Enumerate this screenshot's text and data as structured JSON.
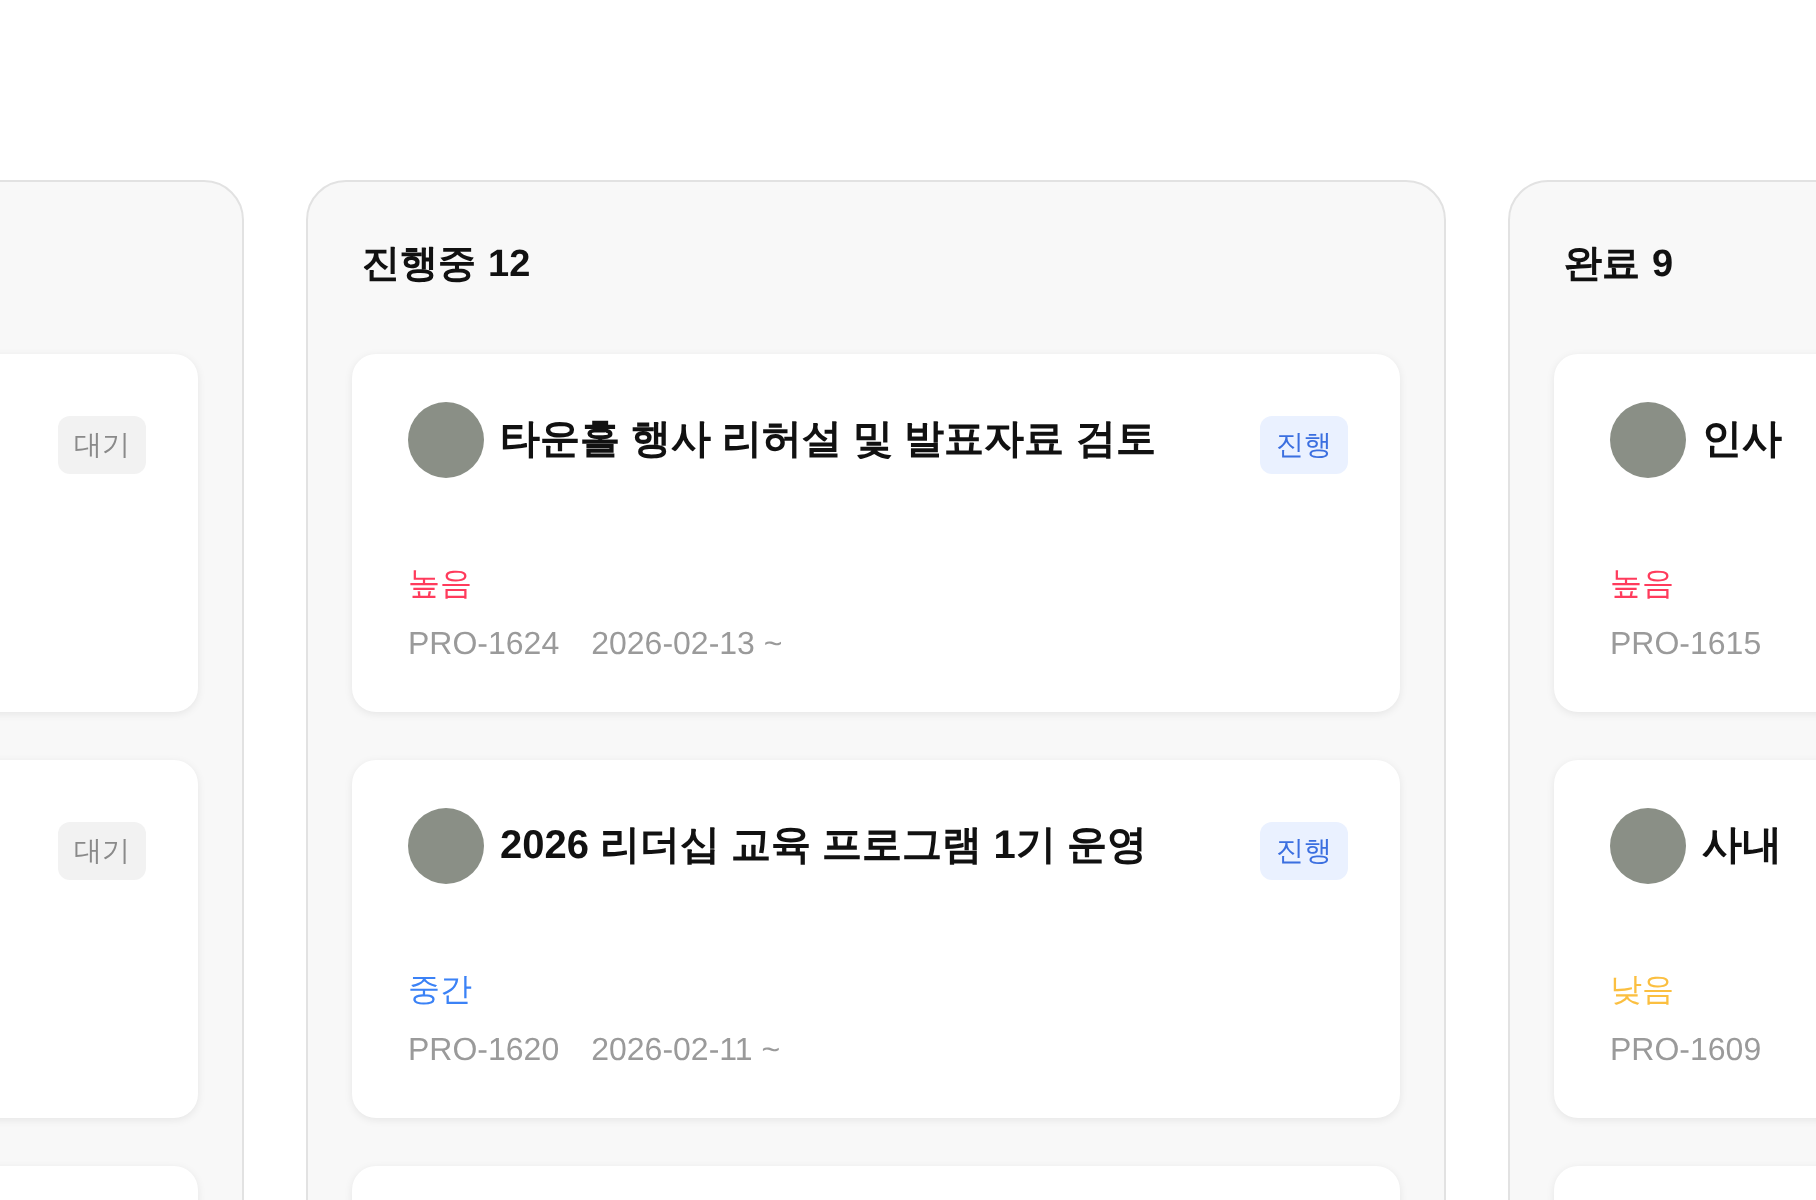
{
  "columns": [
    {
      "cards": [
        {
          "kind": "task",
          "status": {
            "label": "대기",
            "kind": "waiting"
          }
        },
        {
          "kind": "task",
          "status": {
            "label": "대기",
            "kind": "waiting"
          }
        },
        {
          "kind": "task"
        }
      ]
    },
    {
      "title": "진행중",
      "count": "12",
      "cards": [
        {
          "kind": "task",
          "title": "타운홀 행사 리허설 및 발표자료 검토",
          "status": {
            "label": "진행",
            "kind": "progress"
          },
          "priority": {
            "label": "높음",
            "color": "#ff3b5c"
          },
          "id": "PRO-1624",
          "date": "2026-02-13 ~"
        },
        {
          "kind": "task",
          "title": "2026 리더십 교육 프로그램 1기 운영",
          "status": {
            "label": "진행",
            "kind": "progress"
          },
          "priority": {
            "label": "중간",
            "color": "#3b82f6"
          },
          "id": "PRO-1620",
          "date": "2026-02-11 ~"
        },
        {
          "kind": "task"
        }
      ]
    },
    {
      "title": "완료",
      "count": "9",
      "cards": [
        {
          "kind": "task",
          "title": "인사",
          "priority": {
            "label": "높음",
            "color": "#ff3b5c"
          },
          "id": "PRO-1615"
        },
        {
          "kind": "task",
          "title": "사내",
          "priority": {
            "label": "낮음",
            "color": "#fbbf40"
          },
          "id": "PRO-1609"
        },
        {
          "kind": "task"
        }
      ]
    }
  ]
}
